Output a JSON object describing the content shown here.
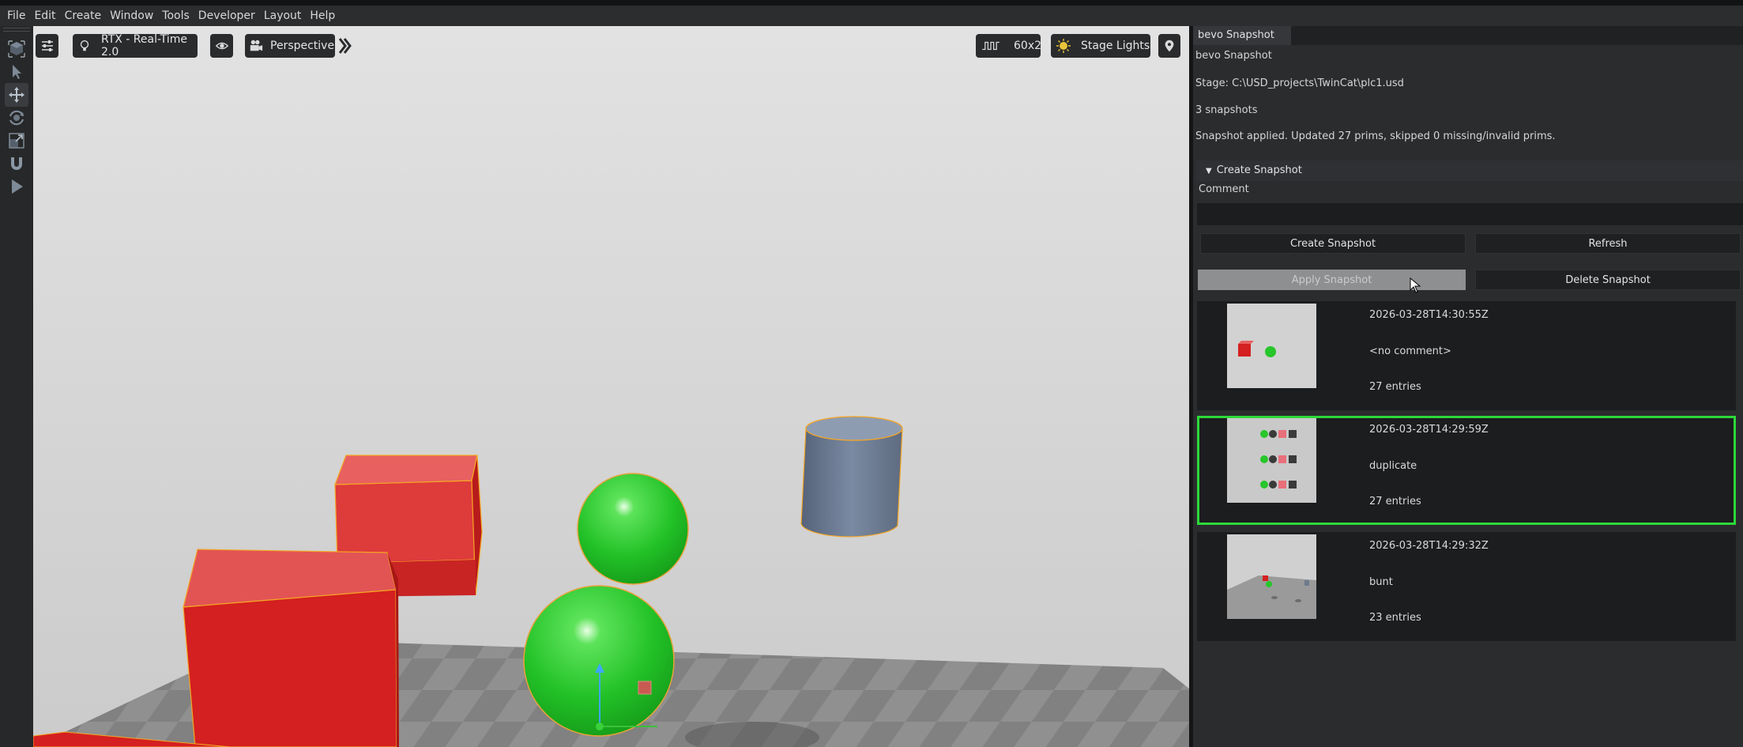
{
  "menubar": {
    "items": [
      "File",
      "Edit",
      "Create",
      "Window",
      "Tools",
      "Developer",
      "Layout",
      "Help"
    ]
  },
  "toolbar_left": {
    "icons": [
      "cube-select-icon",
      "pointer-icon",
      "move-icon",
      "rotate-icon",
      "scale-icon",
      "snap-magnet-icon",
      "play-icon"
    ]
  },
  "viewport": {
    "renderer_label": "RTX - Real-Time 2.0",
    "camera_label": "Perspective",
    "fps_label": "60x2",
    "lights_label": "Stage Lights"
  },
  "panel": {
    "tab_title": "bevo Snapshot",
    "heading": "bevo Snapshot",
    "stage_path": "Stage: C:\\USD_projects\\TwinCat\\plc1.usd",
    "snapshot_count": "3 snapshots",
    "status_message": "Snapshot applied. Updated 27 prims, skipped 0 missing/invalid prims.",
    "create_section_title": "Create Snapshot",
    "comment_label": "Comment",
    "comment_value": "",
    "buttons": {
      "create": "Create Snapshot",
      "refresh": "Refresh",
      "apply": "Apply Snapshot",
      "delete": "Delete Snapshot"
    },
    "snapshots": [
      {
        "timestamp": "2026-03-28T14:30:55Z",
        "comment": "<no comment>",
        "entries": "27 entries",
        "selected": false
      },
      {
        "timestamp": "2026-03-28T14:29:59Z",
        "comment": "duplicate",
        "entries": "27 entries",
        "selected": true
      },
      {
        "timestamp": "2026-03-28T14:29:32Z",
        "comment": "bunt",
        "entries": "23 entries",
        "selected": false
      }
    ]
  },
  "colors": {
    "selection_outline": "#2cd93a",
    "cube_red": "#d42020",
    "sphere_green": "#27c62a",
    "cylinder_gray": "#6d7a8c"
  }
}
